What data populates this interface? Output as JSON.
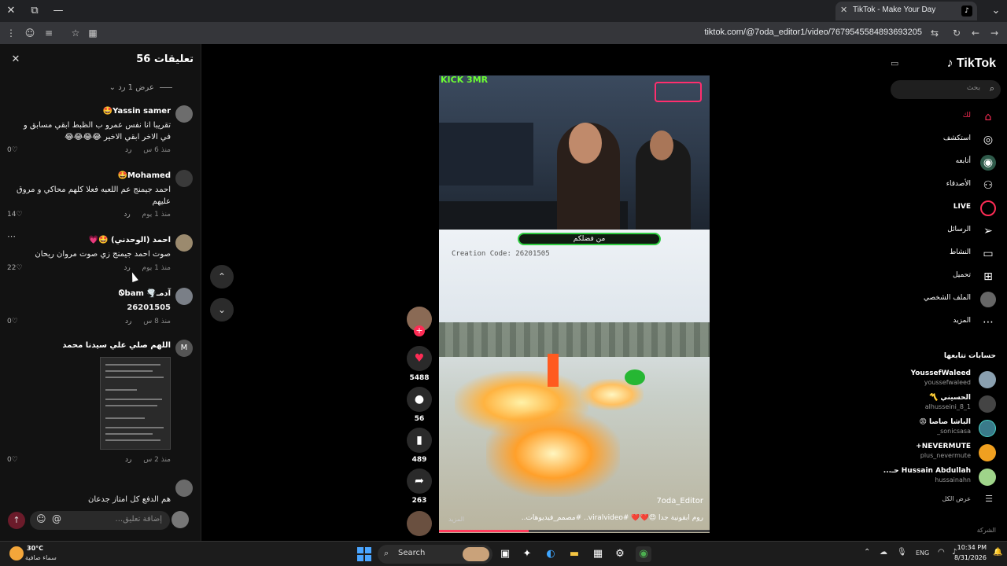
{
  "browser": {
    "tab_title": "TikTok - Make Your Day",
    "url": "tiktok.com/@7oda_editor1/video/7679545584893693205"
  },
  "comments_panel": {
    "title": "تعليقات 56",
    "show_replies": "عرض 1 رد",
    "comments": [
      {
        "user": "Yassin samer🤩",
        "text": "تقريبا انا نفس عمرو ب الظبط ابقي مسابق و في الاخر ابقي الاخير 😂😂😂😂",
        "time": "منذ 6 س",
        "reply": "رد",
        "likes": "0"
      },
      {
        "user": "Mohamed🤩",
        "text": "احمد جيمنج عم اللعبه فعلا كلهم محاكي و مروق عليهم",
        "time": "منذ 1 يوم",
        "reply": "رد",
        "likes": "14"
      },
      {
        "user": "احمد (الوحدني) 🤩💗",
        "text": "صوت احمد جيمنج زي صوت مروان ريحان",
        "time": "منذ 1 يوم",
        "reply": "رد",
        "likes": "22"
      },
      {
        "user": "آدمـ🌪️ Ꮻbam",
        "text": "26201505",
        "time": "منذ 8 س",
        "reply": "رد",
        "likes": "0"
      },
      {
        "user": "اللهم صلي علي سيدنا محمد",
        "text": "",
        "time": "منذ 2 س",
        "reply": "رد",
        "likes": "0"
      },
      {
        "user": "",
        "text": "هم الدفع كل امتاز جدعان",
        "time": "",
        "reply": "",
        "likes": ""
      }
    ],
    "avatar_letter": "M",
    "add_comment_placeholder": "إضافة تعليق..."
  },
  "video": {
    "hud_text": "من فضلكم",
    "creation_code": "Creation Code: 26201505",
    "cam_logo": "KICK 3MR",
    "author": "7oda_Editor",
    "caption": "روم أبقونية جدا 😍❤️❤️ #viralvideo.. #مصمم_فيديوهات..",
    "more": "المزيد",
    "progress": 0.33
  },
  "actions": {
    "likes": "5488",
    "comments": "56",
    "saves": "489",
    "shares": "263"
  },
  "sidebar": {
    "brand": "TikTok",
    "search_placeholder": "بحث",
    "nav": [
      {
        "label": "لك",
        "icon": "home-icon"
      },
      {
        "label": "استكشف",
        "icon": "compass-icon"
      },
      {
        "label": "أتابعه",
        "icon": "following-icon"
      },
      {
        "label": "الأصدقاء",
        "icon": "friends-icon"
      },
      {
        "label": "LIVE",
        "icon": "live-icon"
      },
      {
        "label": "الرسائل",
        "icon": "send-icon"
      },
      {
        "label": "النشاط",
        "icon": "inbox-icon"
      },
      {
        "label": "تحميل",
        "icon": "upload-icon"
      },
      {
        "label": "الملف الشخصي",
        "icon": "profile-icon"
      },
      {
        "label": "المزيد",
        "icon": "more-icon"
      }
    ],
    "following_title": "حسابات تتابعها",
    "accounts": [
      {
        "name": "YoussefWaleed",
        "handle": "youssefwaleed"
      },
      {
        "name": "الحسيني 〽️",
        "handle": "alhusseini_8_1"
      },
      {
        "name": "الباشا صاصا 😡",
        "handle": "_sonicsasa"
      },
      {
        "name": "NEVERMUTE+",
        "handle": "plus_nevermute"
      },
      {
        "name": "Hussain Abdullah حـ...",
        "handle": "hussainahn"
      }
    ],
    "see_all": "عرض الكل",
    "company": "الشركة"
  },
  "taskbar": {
    "temperature": "30°C",
    "weather": "سماء صافية",
    "search_label": "Search",
    "language": "ENG",
    "time": "10:34 PM",
    "date": "8/31/2026"
  },
  "colors": {
    "accent": "#fe2c55",
    "panel_bg": "#121212",
    "hud_green": "#2ecc40"
  }
}
